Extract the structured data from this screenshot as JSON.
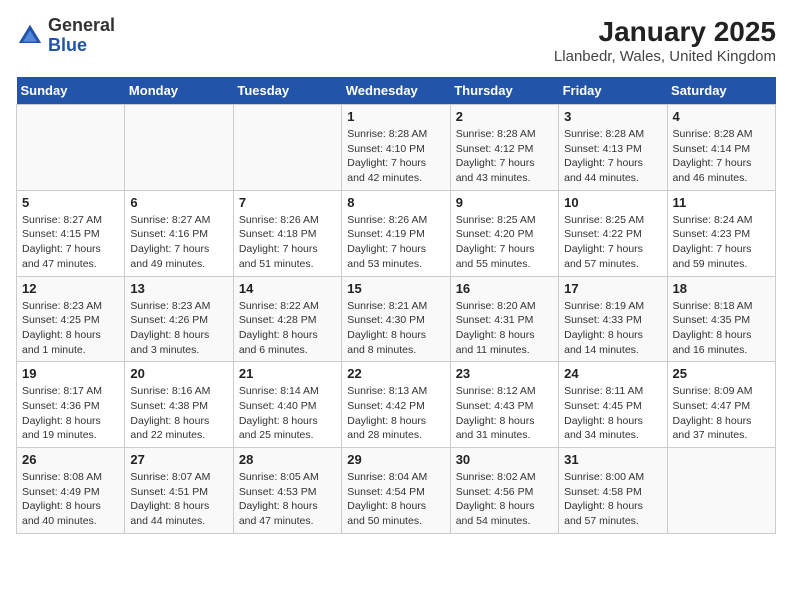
{
  "logo": {
    "text_general": "General",
    "text_blue": "Blue"
  },
  "title": "January 2025",
  "subtitle": "Llanbedr, Wales, United Kingdom",
  "days_of_week": [
    "Sunday",
    "Monday",
    "Tuesday",
    "Wednesday",
    "Thursday",
    "Friday",
    "Saturday"
  ],
  "weeks": [
    [
      {
        "day": "",
        "sunrise": "",
        "sunset": "",
        "daylight": ""
      },
      {
        "day": "",
        "sunrise": "",
        "sunset": "",
        "daylight": ""
      },
      {
        "day": "",
        "sunrise": "",
        "sunset": "",
        "daylight": ""
      },
      {
        "day": "1",
        "sunrise": "Sunrise: 8:28 AM",
        "sunset": "Sunset: 4:10 PM",
        "daylight": "Daylight: 7 hours and 42 minutes."
      },
      {
        "day": "2",
        "sunrise": "Sunrise: 8:28 AM",
        "sunset": "Sunset: 4:12 PM",
        "daylight": "Daylight: 7 hours and 43 minutes."
      },
      {
        "day": "3",
        "sunrise": "Sunrise: 8:28 AM",
        "sunset": "Sunset: 4:13 PM",
        "daylight": "Daylight: 7 hours and 44 minutes."
      },
      {
        "day": "4",
        "sunrise": "Sunrise: 8:28 AM",
        "sunset": "Sunset: 4:14 PM",
        "daylight": "Daylight: 7 hours and 46 minutes."
      }
    ],
    [
      {
        "day": "5",
        "sunrise": "Sunrise: 8:27 AM",
        "sunset": "Sunset: 4:15 PM",
        "daylight": "Daylight: 7 hours and 47 minutes."
      },
      {
        "day": "6",
        "sunrise": "Sunrise: 8:27 AM",
        "sunset": "Sunset: 4:16 PM",
        "daylight": "Daylight: 7 hours and 49 minutes."
      },
      {
        "day": "7",
        "sunrise": "Sunrise: 8:26 AM",
        "sunset": "Sunset: 4:18 PM",
        "daylight": "Daylight: 7 hours and 51 minutes."
      },
      {
        "day": "8",
        "sunrise": "Sunrise: 8:26 AM",
        "sunset": "Sunset: 4:19 PM",
        "daylight": "Daylight: 7 hours and 53 minutes."
      },
      {
        "day": "9",
        "sunrise": "Sunrise: 8:25 AM",
        "sunset": "Sunset: 4:20 PM",
        "daylight": "Daylight: 7 hours and 55 minutes."
      },
      {
        "day": "10",
        "sunrise": "Sunrise: 8:25 AM",
        "sunset": "Sunset: 4:22 PM",
        "daylight": "Daylight: 7 hours and 57 minutes."
      },
      {
        "day": "11",
        "sunrise": "Sunrise: 8:24 AM",
        "sunset": "Sunset: 4:23 PM",
        "daylight": "Daylight: 7 hours and 59 minutes."
      }
    ],
    [
      {
        "day": "12",
        "sunrise": "Sunrise: 8:23 AM",
        "sunset": "Sunset: 4:25 PM",
        "daylight": "Daylight: 8 hours and 1 minute."
      },
      {
        "day": "13",
        "sunrise": "Sunrise: 8:23 AM",
        "sunset": "Sunset: 4:26 PM",
        "daylight": "Daylight: 8 hours and 3 minutes."
      },
      {
        "day": "14",
        "sunrise": "Sunrise: 8:22 AM",
        "sunset": "Sunset: 4:28 PM",
        "daylight": "Daylight: 8 hours and 6 minutes."
      },
      {
        "day": "15",
        "sunrise": "Sunrise: 8:21 AM",
        "sunset": "Sunset: 4:30 PM",
        "daylight": "Daylight: 8 hours and 8 minutes."
      },
      {
        "day": "16",
        "sunrise": "Sunrise: 8:20 AM",
        "sunset": "Sunset: 4:31 PM",
        "daylight": "Daylight: 8 hours and 11 minutes."
      },
      {
        "day": "17",
        "sunrise": "Sunrise: 8:19 AM",
        "sunset": "Sunset: 4:33 PM",
        "daylight": "Daylight: 8 hours and 14 minutes."
      },
      {
        "day": "18",
        "sunrise": "Sunrise: 8:18 AM",
        "sunset": "Sunset: 4:35 PM",
        "daylight": "Daylight: 8 hours and 16 minutes."
      }
    ],
    [
      {
        "day": "19",
        "sunrise": "Sunrise: 8:17 AM",
        "sunset": "Sunset: 4:36 PM",
        "daylight": "Daylight: 8 hours and 19 minutes."
      },
      {
        "day": "20",
        "sunrise": "Sunrise: 8:16 AM",
        "sunset": "Sunset: 4:38 PM",
        "daylight": "Daylight: 8 hours and 22 minutes."
      },
      {
        "day": "21",
        "sunrise": "Sunrise: 8:14 AM",
        "sunset": "Sunset: 4:40 PM",
        "daylight": "Daylight: 8 hours and 25 minutes."
      },
      {
        "day": "22",
        "sunrise": "Sunrise: 8:13 AM",
        "sunset": "Sunset: 4:42 PM",
        "daylight": "Daylight: 8 hours and 28 minutes."
      },
      {
        "day": "23",
        "sunrise": "Sunrise: 8:12 AM",
        "sunset": "Sunset: 4:43 PM",
        "daylight": "Daylight: 8 hours and 31 minutes."
      },
      {
        "day": "24",
        "sunrise": "Sunrise: 8:11 AM",
        "sunset": "Sunset: 4:45 PM",
        "daylight": "Daylight: 8 hours and 34 minutes."
      },
      {
        "day": "25",
        "sunrise": "Sunrise: 8:09 AM",
        "sunset": "Sunset: 4:47 PM",
        "daylight": "Daylight: 8 hours and 37 minutes."
      }
    ],
    [
      {
        "day": "26",
        "sunrise": "Sunrise: 8:08 AM",
        "sunset": "Sunset: 4:49 PM",
        "daylight": "Daylight: 8 hours and 40 minutes."
      },
      {
        "day": "27",
        "sunrise": "Sunrise: 8:07 AM",
        "sunset": "Sunset: 4:51 PM",
        "daylight": "Daylight: 8 hours and 44 minutes."
      },
      {
        "day": "28",
        "sunrise": "Sunrise: 8:05 AM",
        "sunset": "Sunset: 4:53 PM",
        "daylight": "Daylight: 8 hours and 47 minutes."
      },
      {
        "day": "29",
        "sunrise": "Sunrise: 8:04 AM",
        "sunset": "Sunset: 4:54 PM",
        "daylight": "Daylight: 8 hours and 50 minutes."
      },
      {
        "day": "30",
        "sunrise": "Sunrise: 8:02 AM",
        "sunset": "Sunset: 4:56 PM",
        "daylight": "Daylight: 8 hours and 54 minutes."
      },
      {
        "day": "31",
        "sunrise": "Sunrise: 8:00 AM",
        "sunset": "Sunset: 4:58 PM",
        "daylight": "Daylight: 8 hours and 57 minutes."
      },
      {
        "day": "",
        "sunrise": "",
        "sunset": "",
        "daylight": ""
      }
    ]
  ]
}
